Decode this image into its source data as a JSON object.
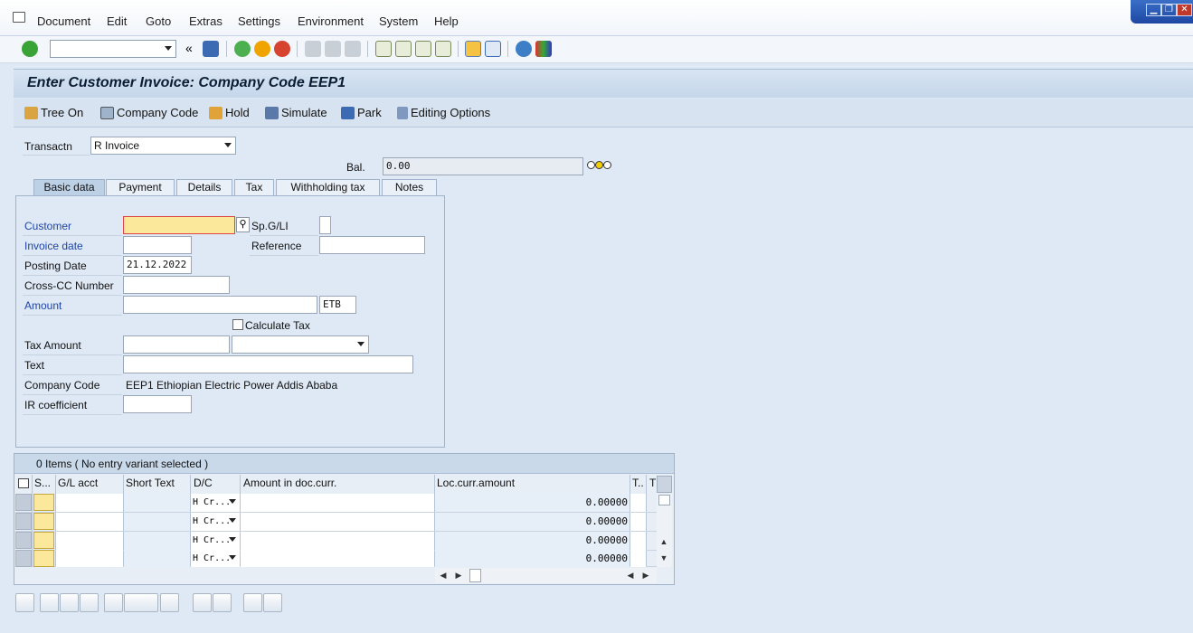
{
  "menu": {
    "items": [
      {
        "label": "Document"
      },
      {
        "label": "Edit"
      },
      {
        "label": "Goto"
      },
      {
        "label": "Extras"
      },
      {
        "label": "Settings"
      },
      {
        "label": "Environment"
      },
      {
        "label": "System"
      },
      {
        "label": "Help"
      }
    ]
  },
  "window_controls": {
    "minimize": "▁",
    "restore": "❐",
    "close": "✕"
  },
  "toolbar": {
    "command_field": "",
    "back_glyph": "«"
  },
  "title": "Enter Customer Invoice: Company Code EEP1",
  "app_toolbar": {
    "tree_on": "Tree On",
    "company_code": "Company Code",
    "hold": "Hold",
    "simulate": "Simulate",
    "park": "Park",
    "editing_options": "Editing Options"
  },
  "transaction": {
    "label": "Transactn",
    "value": "R Invoice"
  },
  "balance": {
    "label": "Bal.",
    "value": "0.00"
  },
  "tabs": [
    {
      "label": "Basic data",
      "active": true
    },
    {
      "label": "Payment"
    },
    {
      "label": "Details"
    },
    {
      "label": "Tax"
    },
    {
      "label": "Withholding tax"
    },
    {
      "label": "Notes"
    }
  ],
  "basic_data": {
    "customer_label": "Customer",
    "customer_value": "",
    "spgl_label": "Sp.G/LI",
    "invoice_date_label": "Invoice date",
    "reference_label": "Reference",
    "posting_date_label": "Posting Date",
    "posting_date_value": "21.12.2022",
    "cross_cc_label": "Cross-CC Number",
    "amount_label": "Amount",
    "currency": "ETB",
    "calculate_tax_label": "Calculate Tax",
    "tax_amount_label": "Tax Amount",
    "text_label": "Text",
    "company_code_label": "Company Code",
    "company_code_value": "EEP1 Ethiopian Electric Power Addis Ababa",
    "ir_coefficient_label": "IR coefficient"
  },
  "items_grid": {
    "header": "0 Items ( No entry variant selected )",
    "columns": [
      "S...",
      "G/L acct",
      "Short Text",
      "D/C",
      "Amount in doc.curr.",
      "Loc.curr.amount",
      "T..",
      "T"
    ],
    "rows": [
      {
        "dc": "H Cr...",
        "loc_amount": "0.00000"
      },
      {
        "dc": "H Cr...",
        "loc_amount": "0.00000"
      },
      {
        "dc": "H Cr...",
        "loc_amount": "0.00000"
      },
      {
        "dc": "H Cr...",
        "loc_amount": "0.00000"
      }
    ]
  },
  "colors": {
    "required_label": "#1f45a8",
    "yellow_field": "#fbe89a",
    "accent_title": "#c4d6ea"
  }
}
